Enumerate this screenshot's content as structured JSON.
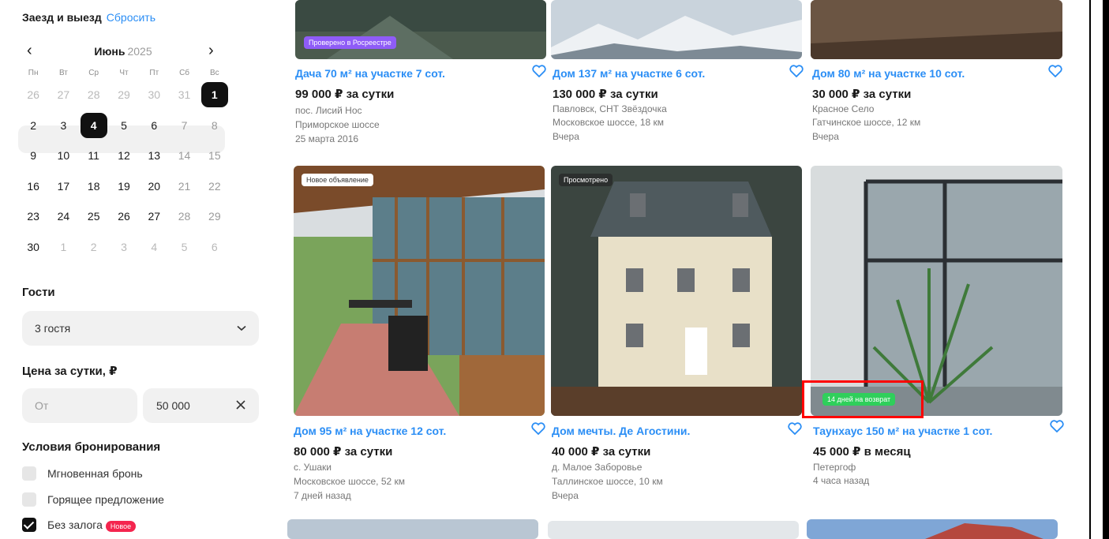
{
  "filters": {
    "dates_title": "Заезд и выезд",
    "reset_label": "Сбросить",
    "calendar": {
      "month": "Июнь",
      "year": "2025",
      "prev_icon": "chevron-left-icon",
      "next_icon": "chevron-right-icon",
      "weekdays": [
        "Пн",
        "Вт",
        "Ср",
        "Чт",
        "Пт",
        "Сб",
        "Вс"
      ],
      "weeks": [
        [
          "26",
          "27",
          "28",
          "29",
          "30",
          "31",
          "1"
        ],
        [
          "2",
          "3",
          "4",
          "5",
          "6",
          "7",
          "8"
        ],
        [
          "9",
          "10",
          "11",
          "12",
          "13",
          "14",
          "15"
        ],
        [
          "16",
          "17",
          "18",
          "19",
          "20",
          "21",
          "22"
        ],
        [
          "23",
          "24",
          "25",
          "26",
          "27",
          "28",
          "29"
        ],
        [
          "30",
          "1",
          "2",
          "3",
          "4",
          "5",
          "6"
        ]
      ],
      "selected_start": "1",
      "selected_end": "4"
    },
    "guests_title": "Гости",
    "guests_value": "3 гостя",
    "price_title": "Цена за сутки, ₽",
    "price_from_placeholder": "От",
    "price_to_value": "50 000",
    "conditions_title": "Условия бронирования",
    "conditions": [
      {
        "label": "Мгновенная бронь",
        "checked": false
      },
      {
        "label": "Горящее предложение",
        "checked": false
      },
      {
        "label": "Без залога",
        "checked": true,
        "badge": "Новое"
      }
    ]
  },
  "listings": [
    {
      "title": "Дача 70 м² на участке 7 сот.",
      "price": "99 000 ₽ за сутки",
      "lines": [
        "пос. Лисий Нос",
        "Приморское шоссе",
        "25 марта 2016"
      ],
      "tag": "Проверено в Росреестре"
    },
    {
      "title": "Дом 137 м² на участке 6 сот.",
      "price": "130 000 ₽ за сутки",
      "lines": [
        "Павловск, СНТ Звёздочка",
        "Московское шоссе, 18 км",
        "Вчера"
      ]
    },
    {
      "title": "Дом 80 м² на участке 10 сот.",
      "price": "30 000 ₽ за сутки",
      "lines": [
        "Красное Село",
        "Гатчинское шоссе, 12 км",
        "Вчера"
      ]
    },
    {
      "title": "Дом 95 м² на участке 12 сот.",
      "price": "80 000 ₽ за сутки",
      "lines": [
        "с. Ушаки",
        "Московское шоссе, 52 км",
        "7 дней назад"
      ],
      "tag": "Новое объявление"
    },
    {
      "title": "Дом мечты. Де Агостини.",
      "price": "40 000 ₽ за сутки",
      "lines": [
        "д. Малое Заборовье",
        "Таллинское шоссе, 10 км",
        "Вчера"
      ],
      "tag": "Просмотрено"
    },
    {
      "title": "Таунхаус 150 м² на участке 1 сот.",
      "price": "45 000 ₽ в месяц",
      "lines": [
        "Петергоф",
        "4 часа назад"
      ],
      "tag": "14 дней на возврат"
    }
  ],
  "icons": {
    "favorite": "heart-icon",
    "clear": "close-icon",
    "dropdown": "chevron-down-icon"
  },
  "colors": {
    "accent": "#2b8ef5",
    "selected_day": "#111111",
    "highlight": "#ff0000",
    "rosreestr_tag": "#8f5cf7",
    "return_tag": "#2fcf5b",
    "new_badge": "#f4254e"
  }
}
